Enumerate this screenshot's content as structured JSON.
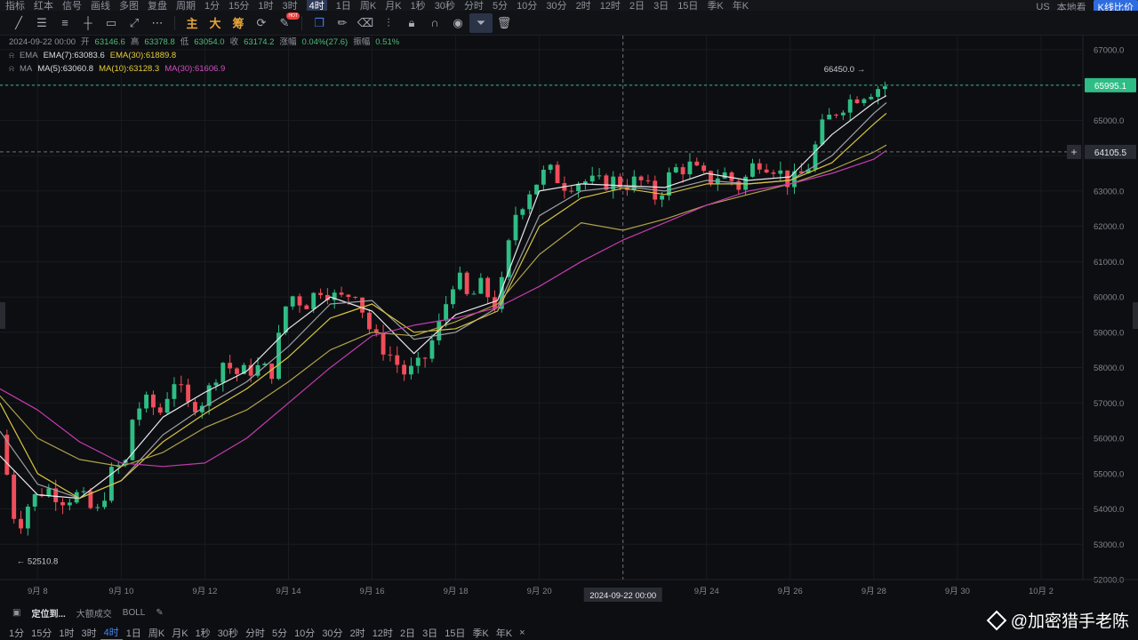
{
  "topbar": {
    "items": [
      "指标",
      "红本",
      "信号",
      "画线",
      "多图",
      "复盘",
      "周期",
      "1分",
      "15分",
      "1时",
      "3时",
      "4时",
      "1日",
      "周K",
      "月K",
      "1秒",
      "30秒",
      "分时",
      "5分",
      "10分",
      "30分",
      "2时",
      "12时",
      "2日",
      "3日",
      "15日",
      "季K",
      "年K"
    ],
    "active": "4时",
    "right": [
      "US",
      "本地看",
      "K线比价"
    ]
  },
  "toolbar": {
    "main_label": "主",
    "big_label": "大",
    "chip_label": "筹",
    "hot_badge": "HOT"
  },
  "info": {
    "date": "2024-09-22 00:00",
    "open_label": "开",
    "open": "63146.6",
    "high_label": "高",
    "high": "63378.8",
    "low_label": "低",
    "low": "63054.0",
    "close_label": "收",
    "close": "63174.2",
    "change_label": "涨幅",
    "change": "0.04%(27.6)",
    "amp_label": "振幅",
    "amp": "0.51%",
    "ema_name": "EMA",
    "ema7": "EMA(7):63083.6",
    "ema30": "EMA(30):61889.8",
    "ma_name": "MA",
    "ma5": "MA(5):63060.8",
    "ma10": "MA(10):63128.3",
    "ma30": "MA(30):61606.9"
  },
  "colors": {
    "up": "#2ebd85",
    "down": "#f04d5a",
    "ma5": "#e8e8ec",
    "ma10": "#9d9fa6",
    "ma30": "#c43bb0",
    "ema7": "#d7c440",
    "ema30": "#b0a24a",
    "price_tag": "#2ebd85",
    "crosshair_tag": "#2a2c33"
  },
  "chart_data": {
    "type": "candlestick",
    "title": "",
    "ylim": [
      52000,
      67400
    ],
    "y_ticks": [
      52000,
      53000,
      54000,
      55000,
      56000,
      57000,
      58000,
      59000,
      60000,
      61000,
      62000,
      63000,
      64000,
      65000,
      66000,
      67000
    ],
    "y_tick_labels": [
      "52000.0",
      "53000.0",
      "54000.0",
      "55000.0",
      "56000.0",
      "57000.0",
      "58000.0",
      "59000.0",
      "60000.0",
      "61000.0",
      "62000.0",
      "63000.0",
      "64000.0",
      "65000.0",
      "66000.0",
      "67000.0"
    ],
    "x_labels": [
      "9月 8",
      "9月 10",
      "9月 12",
      "9月 14",
      "9月 16",
      "9月 18",
      "9月 20",
      "9月 24",
      "9月 26",
      "9月 28",
      "9月 30",
      "10月 2"
    ],
    "x_label_days": [
      8,
      10,
      12,
      14,
      16,
      18,
      20,
      24,
      26,
      28,
      30,
      32
    ],
    "x_start_day": 7.1,
    "x_end_day": 33.0,
    "bars_per_day": 6,
    "price_line": 65995.1,
    "price_line_label": "65995.1",
    "crosshair_price": 64105.5,
    "crosshair_price_label": "64105.5",
    "crosshair_time_label": "2024-09-22 00:00",
    "crosshair_day": 22,
    "high_marker": 66450.0,
    "high_marker_label": "66450.0",
    "low_marker": 52510.8,
    "low_marker_label": "52510.8",
    "close_path": [
      [
        7.1,
        56100
      ],
      [
        7.5,
        53400
      ],
      [
        7.8,
        54200
      ],
      [
        8.2,
        54600
      ],
      [
        8.6,
        54300
      ],
      [
        9.0,
        54400
      ],
      [
        9.4,
        53800
      ],
      [
        9.8,
        55100
      ],
      [
        10.1,
        55300
      ],
      [
        10.3,
        56800
      ],
      [
        10.6,
        57000
      ],
      [
        11.0,
        56700
      ],
      [
        11.2,
        57800
      ],
      [
        11.6,
        56900
      ],
      [
        12.0,
        57100
      ],
      [
        12.4,
        58200
      ],
      [
        12.8,
        57800
      ],
      [
        13.2,
        58000
      ],
      [
        13.6,
        57900
      ],
      [
        14.0,
        60100
      ],
      [
        14.4,
        59800
      ],
      [
        14.8,
        60300
      ],
      [
        15.2,
        59900
      ],
      [
        15.6,
        60200
      ],
      [
        16.0,
        58900
      ],
      [
        16.4,
        58400
      ],
      [
        16.8,
        57800
      ],
      [
        17.2,
        58100
      ],
      [
        17.6,
        59200
      ],
      [
        18.0,
        60700
      ],
      [
        18.3,
        59900
      ],
      [
        18.6,
        60300
      ],
      [
        19.0,
        59700
      ],
      [
        19.4,
        62300
      ],
      [
        19.8,
        63100
      ],
      [
        20.2,
        63600
      ],
      [
        20.6,
        63200
      ],
      [
        21.0,
        63300
      ],
      [
        21.4,
        63200
      ],
      [
        21.8,
        63300
      ],
      [
        22.0,
        63174
      ],
      [
        22.4,
        63300
      ],
      [
        22.8,
        62800
      ],
      [
        23.2,
        63600
      ],
      [
        23.6,
        63700
      ],
      [
        24.0,
        63300
      ],
      [
        24.4,
        63500
      ],
      [
        24.8,
        63100
      ],
      [
        25.2,
        63900
      ],
      [
        25.6,
        63700
      ],
      [
        26.0,
        63200
      ],
      [
        26.4,
        63600
      ],
      [
        26.8,
        64900
      ],
      [
        27.2,
        65400
      ],
      [
        27.6,
        65700
      ],
      [
        28.0,
        65900
      ],
      [
        28.3,
        65995
      ]
    ],
    "series": [
      {
        "name": "MA(5)",
        "x": [
          7.1,
          8,
          9,
          10,
          11,
          12,
          13,
          14,
          15,
          16,
          17,
          18,
          19,
          20,
          21,
          22,
          23,
          24,
          25,
          26,
          27,
          28,
          28.3
        ],
        "values": [
          55500,
          54400,
          54300,
          55200,
          56600,
          57300,
          57900,
          59100,
          60000,
          59600,
          58400,
          59500,
          59900,
          63000,
          63200,
          63150,
          63100,
          63500,
          63300,
          63400,
          64600,
          65500,
          65700
        ]
      },
      {
        "name": "MA(10)",
        "x": [
          7.1,
          8,
          9,
          10,
          11,
          12,
          13,
          14,
          15,
          16,
          17,
          18,
          19,
          20,
          21,
          22,
          23,
          24,
          25,
          26,
          27,
          28,
          28.3
        ],
        "values": [
          56200,
          54700,
          54300,
          54800,
          56100,
          56900,
          57600,
          58600,
          59800,
          59900,
          58800,
          59000,
          59700,
          62300,
          63000,
          63130,
          63000,
          63300,
          63200,
          63300,
          64000,
          65200,
          65500
        ]
      },
      {
        "name": "EMA(7)",
        "x": [
          7.1,
          8,
          9,
          10,
          11,
          12,
          13,
          14,
          15,
          16,
          17,
          18,
          19,
          20,
          21,
          22,
          23,
          24,
          25,
          26,
          27,
          28,
          28.3
        ],
        "values": [
          57000,
          55000,
          54300,
          54800,
          55900,
          56700,
          57400,
          58300,
          59400,
          59800,
          59000,
          59100,
          59600,
          62000,
          62800,
          63080,
          62900,
          63200,
          63200,
          63300,
          63800,
          64900,
          65200
        ]
      },
      {
        "name": "EMA(30)",
        "x": [
          7.1,
          8,
          9,
          10,
          11,
          12,
          13,
          14,
          15,
          16,
          17,
          18,
          19,
          20,
          21,
          22,
          23,
          24,
          25,
          26,
          27,
          28,
          28.3
        ],
        "values": [
          57200,
          56000,
          55400,
          55200,
          55600,
          56300,
          56800,
          57600,
          58500,
          59000,
          58900,
          59300,
          59800,
          61200,
          62100,
          61890,
          62200,
          62600,
          62900,
          63200,
          63600,
          64100,
          64300
        ]
      },
      {
        "name": "MA(30)",
        "x": [
          7.1,
          8,
          9,
          10,
          11,
          12,
          13,
          14,
          15,
          16,
          17,
          18,
          19,
          20,
          21,
          22,
          23,
          24,
          25,
          26,
          27,
          28,
          28.3
        ],
        "values": [
          57400,
          56800,
          55900,
          55300,
          55200,
          55300,
          56000,
          57000,
          58000,
          58900,
          59200,
          59400,
          59700,
          60300,
          61000,
          61610,
          62100,
          62600,
          63000,
          63200,
          63500,
          63900,
          64150
        ]
      }
    ]
  },
  "bottombar": {
    "locate": "定位到...",
    "big_deal": "大额成交",
    "boll": "BOLL"
  },
  "periods": [
    "1分",
    "15分",
    "1时",
    "3时",
    "4时",
    "1日",
    "周K",
    "月K",
    "1秒",
    "30秒",
    "分时",
    "5分",
    "10分",
    "30分",
    "2时",
    "12时",
    "2日",
    "3日",
    "15日",
    "季K",
    "年K",
    "×"
  ],
  "active_period": "4时",
  "watermark": "@加密猎手老陈"
}
